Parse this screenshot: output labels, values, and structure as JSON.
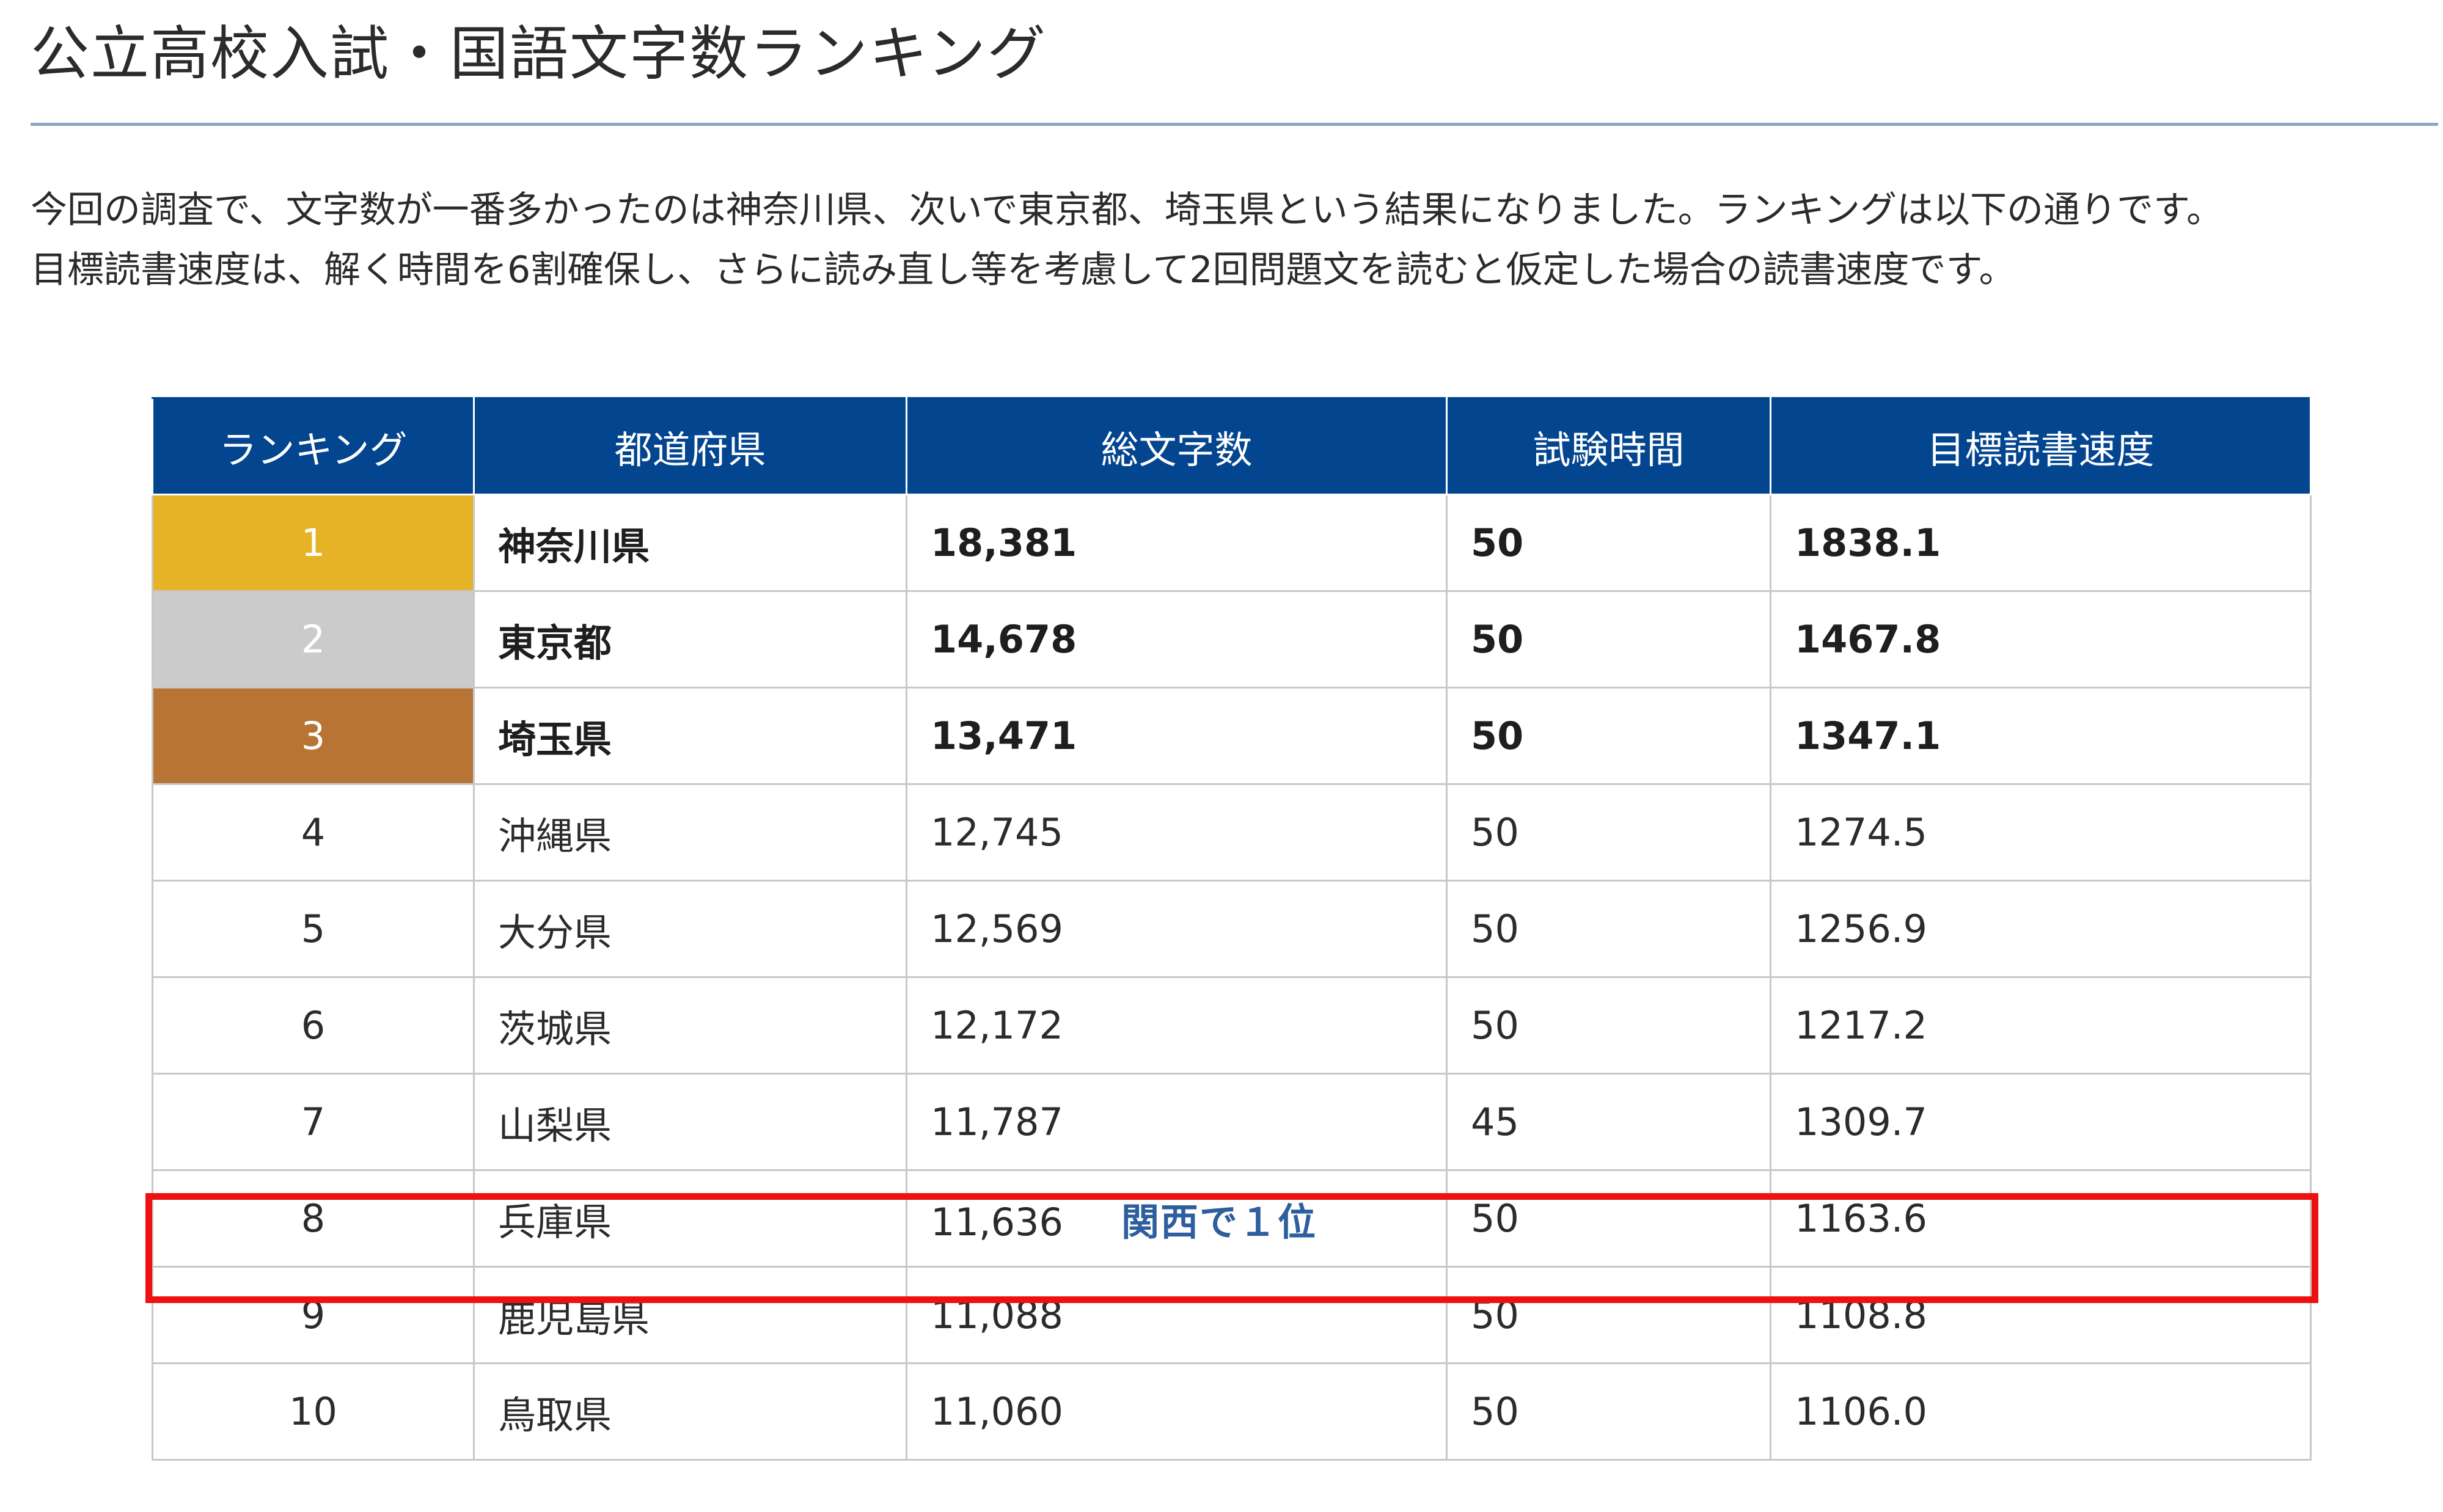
{
  "title": "公立高校入試・国語文字数ランキング",
  "intro": [
    "今回の調査で、文字数が一番多かったのは神奈川県、次いで東京都、埼玉県という結果になりました。ランキングは以下の通りです。",
    "目標読書速度は、解く時間を6割確保し、さらに読み直し等を考慮して2回問題文を読むと仮定した場合の読書速度です。"
  ],
  "table": {
    "headers": [
      "ランキング",
      "都道府県",
      "総文字数",
      "試験時間",
      "目標読書速度"
    ],
    "rows": [
      {
        "rank": "1",
        "prefecture": "神奈川県",
        "chars": "18,381",
        "time": "50",
        "speed": "1838.1"
      },
      {
        "rank": "2",
        "prefecture": "東京都",
        "chars": "14,678",
        "time": "50",
        "speed": "1467.8"
      },
      {
        "rank": "3",
        "prefecture": "埼玉県",
        "chars": "13,471",
        "time": "50",
        "speed": "1347.1"
      },
      {
        "rank": "4",
        "prefecture": "沖縄県",
        "chars": "12,745",
        "time": "50",
        "speed": "1274.5"
      },
      {
        "rank": "5",
        "prefecture": "大分県",
        "chars": "12,569",
        "time": "50",
        "speed": "1256.9"
      },
      {
        "rank": "6",
        "prefecture": "茨城県",
        "chars": "12,172",
        "time": "50",
        "speed": "1217.2"
      },
      {
        "rank": "7",
        "prefecture": "山梨県",
        "chars": "11,787",
        "time": "45",
        "speed": "1309.7"
      },
      {
        "rank": "8",
        "prefecture": "兵庫県",
        "chars": "11,636",
        "time": "50",
        "speed": "1163.6",
        "note": "関西で１位"
      },
      {
        "rank": "9",
        "prefecture": "鹿児島県",
        "chars": "11,088",
        "time": "50",
        "speed": "1108.8"
      },
      {
        "rank": "10",
        "prefecture": "鳥取県",
        "chars": "11,060",
        "time": "50",
        "speed": "1106.0"
      }
    ]
  },
  "colors": {
    "header_bg": "#03458f",
    "gold": "#e5b325",
    "silver": "#cbcbcb",
    "bronze": "#b77434",
    "highlight": "#ee1111",
    "note_text": "#2d5e9e"
  }
}
